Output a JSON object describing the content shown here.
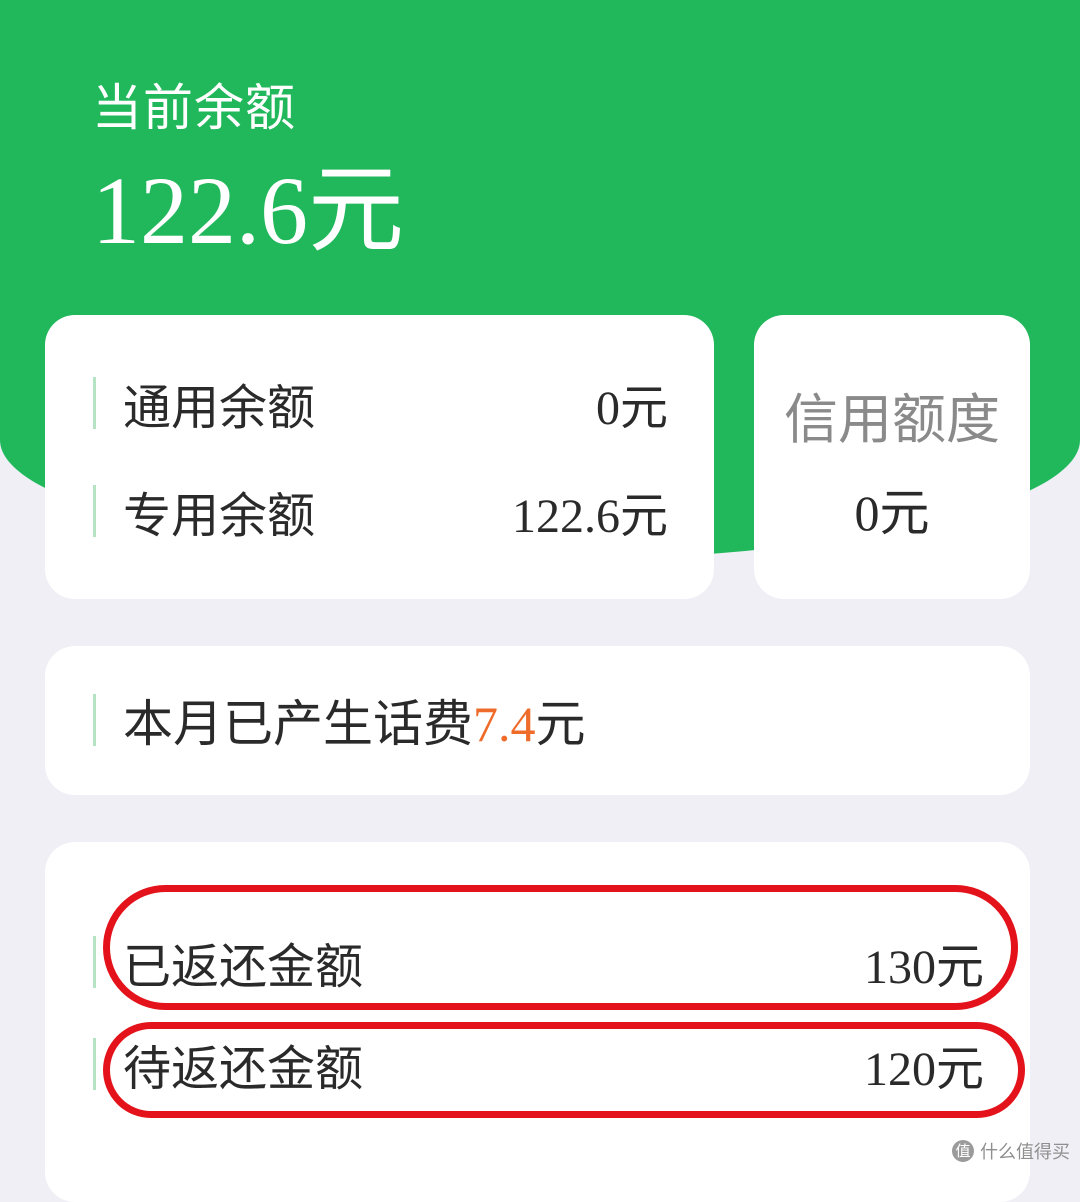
{
  "balance": {
    "label": "当前余额",
    "amount": "122.6元"
  },
  "balance_breakdown": [
    {
      "label": "通用余额",
      "value": "0元"
    },
    {
      "label": "专用余额",
      "value": "122.6元"
    }
  ],
  "credit": {
    "title": "信用额度",
    "value": "0元"
  },
  "monthly_charge": {
    "prefix": "本月已产生话费",
    "amount": "7.4",
    "unit": "元"
  },
  "rebate": [
    {
      "label": "已返还金额",
      "value": "130元"
    },
    {
      "label": "待返还金额",
      "value": "120元"
    }
  ],
  "watermark": {
    "icon_text": "值",
    "text": "什么值得买"
  },
  "colors": {
    "brand_green": "#21b85c",
    "accent_orange": "#ee6b2a",
    "highlight_red": "#e4131b"
  }
}
